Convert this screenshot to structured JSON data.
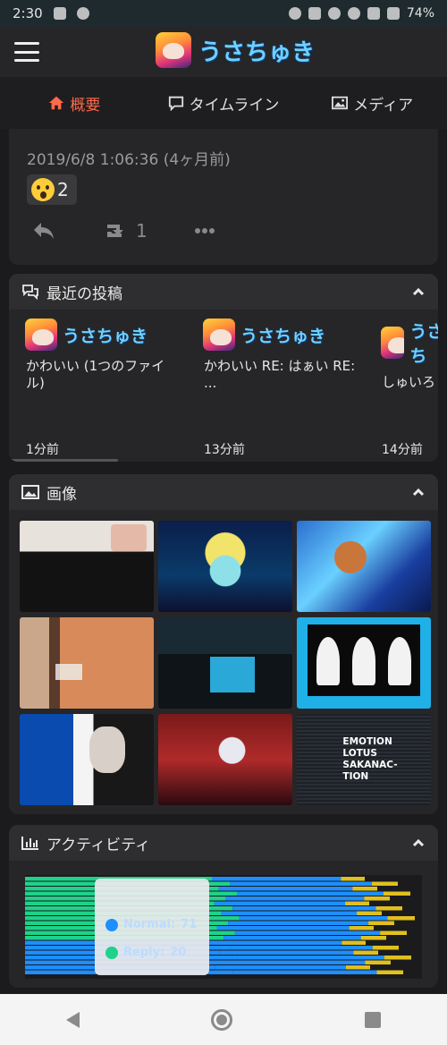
{
  "status_bar": {
    "time": "2:30",
    "battery": "74%"
  },
  "app": {
    "name": "うさちゅき",
    "menu_icon": "hamburger-icon"
  },
  "tabs": [
    {
      "label": "概要",
      "icon": "home-icon",
      "active": true
    },
    {
      "label": "タイムライン",
      "icon": "comment-icon",
      "active": false
    },
    {
      "label": "メディア",
      "icon": "image-icon",
      "active": false
    }
  ],
  "post": {
    "timestamp": "2019/6/8 1:06:36 (4ヶ月前)",
    "reaction": {
      "emoji": "surprised-face-icon",
      "count": "2"
    },
    "renote_count": "1"
  },
  "recent": {
    "title": "最近の投稿",
    "notes": [
      {
        "user": "うさちゅき",
        "text": "かわいい (1つのファイル)",
        "time": "1分前"
      },
      {
        "user": "うさちゅき",
        "text": "かわいい RE: はぁい RE: ...",
        "time": "13分前"
      },
      {
        "user": "うさち",
        "text": "しゅいろ",
        "time": "14分前"
      }
    ]
  },
  "images": {
    "title": "画像",
    "overlay_text": "EMOTION LOTUS SAKANAC- TION",
    "overlay_lines": [
      "EMOTION",
      "LOTUS",
      "SAKANAC-",
      "TION"
    ]
  },
  "activity": {
    "title": "アクティビティ",
    "tooltip": {
      "rows": [
        {
          "label": "Normal:",
          "value": "71",
          "color": "#1e8fff"
        },
        {
          "label": "Reply:",
          "value": "20",
          "color": "#1fd28a"
        }
      ]
    }
  },
  "colors": {
    "accent": "#ff6a4a",
    "brand_text": "#6fd0ff",
    "normal": "#1e8fff",
    "reply": "#1fd28a",
    "renote": "#e0c020"
  }
}
